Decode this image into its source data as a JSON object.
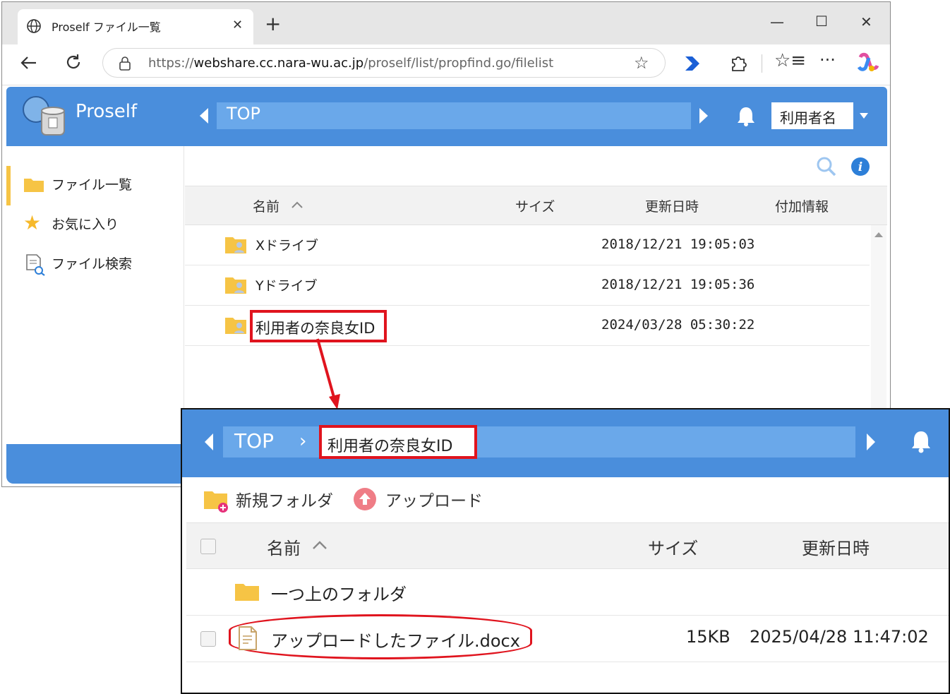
{
  "browser": {
    "tab_title": "Proself ファイル一覧",
    "url_scheme": "https://",
    "url_host": "webshare.cc.nara-wu.ac.jp",
    "url_path": "/proself/list/propfind.go/filelist",
    "controls": {
      "minimize": "—",
      "maximize": "☐",
      "close": "✕",
      "new_tab": "+",
      "tab_close": "✕"
    }
  },
  "app": {
    "logo_text": "Proself",
    "breadcrumb": [
      "TOP"
    ],
    "user_button": "利用者名",
    "sidebar": [
      {
        "label": "ファイル一覧",
        "icon": "folder-icon",
        "active": true
      },
      {
        "label": "お気に入り",
        "icon": "star-icon",
        "active": false
      },
      {
        "label": "ファイル検索",
        "icon": "file-search-icon",
        "active": false
      }
    ],
    "columns": {
      "name": "名前",
      "size": "サイズ",
      "modified": "更新日時",
      "extra": "付加情報"
    },
    "rows": [
      {
        "name": "Xドライブ",
        "modified": "2018/12/21 19:05:03"
      },
      {
        "name": "Yドライブ",
        "modified": "2018/12/21 19:05:36"
      },
      {
        "name": "利用者の奈良女ID",
        "modified": "2024/03/28 05:30:22"
      }
    ]
  },
  "inset": {
    "breadcrumb": [
      "TOP",
      "利用者の奈良女ID"
    ],
    "toolbar": {
      "new_folder": "新規フォルダ",
      "upload": "アップロード"
    },
    "columns": {
      "name": "名前",
      "size": "サイズ",
      "modified": "更新日時"
    },
    "rows": [
      {
        "name": "一つ上のフォルダ",
        "size": "",
        "modified": ""
      },
      {
        "name": "アップロードしたファイル.docx",
        "size": "15KB",
        "modified": "2025/04/28 11:47:02"
      }
    ]
  },
  "colors": {
    "header_blue": "#4a8edc",
    "crumb_blue": "#6aa8ea",
    "highlight_red": "#e0141e",
    "folder_yellow": "#f6c445"
  }
}
